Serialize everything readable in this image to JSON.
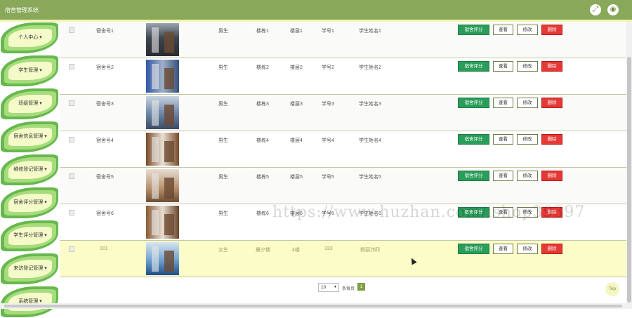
{
  "header": {
    "title": "宿舍管理系统",
    "fullscreen_icon": "expand-icon",
    "user_icon": "user-icon"
  },
  "sidebar": {
    "items": [
      {
        "label": "个人中心"
      },
      {
        "label": "学生管理"
      },
      {
        "label": "班级管理"
      },
      {
        "label": "宿舍信息管理"
      },
      {
        "label": "维修登记管理"
      },
      {
        "label": "宿舍评分管理"
      },
      {
        "label": "学生评分管理"
      },
      {
        "label": "来访登记管理"
      },
      {
        "label": "系统管理"
      }
    ]
  },
  "actions": {
    "score": "宿舍评分",
    "view": "查看",
    "edit": "修改",
    "delete": "删除"
  },
  "rows": [
    {
      "dorm": "宿舍号1",
      "gender": "男生",
      "building": "楼栋1",
      "floor": "楼层1",
      "student_no": "学号1",
      "student_name": "学生姓名1"
    },
    {
      "dorm": "宿舍号2",
      "gender": "男生",
      "building": "楼栋2",
      "floor": "楼层2",
      "student_no": "学号2",
      "student_name": "学生姓名2"
    },
    {
      "dorm": "宿舍号3",
      "gender": "男生",
      "building": "楼栋3",
      "floor": "楼层3",
      "student_no": "学号3",
      "student_name": "学生姓名3"
    },
    {
      "dorm": "宿舍号4",
      "gender": "男生",
      "building": "楼栋4",
      "floor": "楼层4",
      "student_no": "学号4",
      "student_name": "学生姓名4"
    },
    {
      "dorm": "宿舍号5",
      "gender": "男生",
      "building": "楼栋5",
      "floor": "楼层5",
      "student_no": "学号5",
      "student_name": "学生姓名5"
    },
    {
      "dorm": "宿舍号6",
      "gender": "男生",
      "building": "楼栋6",
      "floor": "楼层6",
      "student_no": "学号6",
      "student_name": "学生姓名6"
    },
    {
      "dorm": "001",
      "gender": "女生",
      "building": "晨夕楼",
      "floor": "4楼",
      "student_no": "333",
      "student_name": "杨丽沛四"
    }
  ],
  "pagination": {
    "page_size": "10",
    "per_page_label": "条每页",
    "current_page": "1"
  },
  "top_button": "Top",
  "watermark": "https://www.huzhan.com/ishop39397",
  "colors": {
    "header": "#8aa85a",
    "score_button": "#2a9d5a",
    "delete_button": "#e53935",
    "highlight_row": "#fcfcc8"
  }
}
